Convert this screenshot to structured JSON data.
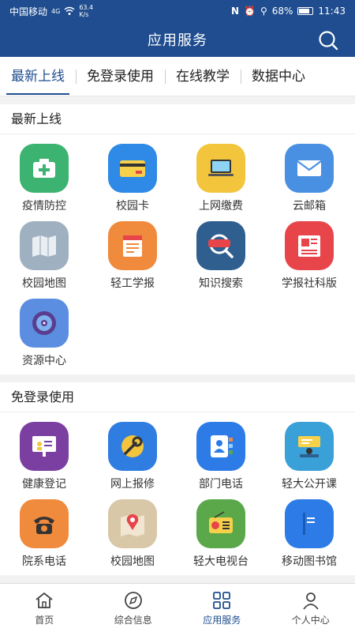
{
  "statusbar": {
    "carrier": "中国移动",
    "network": "4G",
    "speed_value": "63.4",
    "speed_unit": "K/s",
    "battery": "68%",
    "time": "11:43"
  },
  "header": {
    "title": "应用服务",
    "search_icon": "search-icon"
  },
  "tabs": [
    {
      "label": "最新上线",
      "active": true
    },
    {
      "label": "免登录使用",
      "active": false
    },
    {
      "label": "在线教学",
      "active": false
    },
    {
      "label": "数据中心",
      "active": false
    }
  ],
  "sections": [
    {
      "title": "最新上线",
      "items": [
        {
          "label": "疫情防控",
          "icon": "medical-kit-icon",
          "color": "#3cb371"
        },
        {
          "label": "校园卡",
          "icon": "card-icon",
          "color": "#2e8ae6"
        },
        {
          "label": "上网缴费",
          "icon": "laptop-icon",
          "color": "#f2c53d"
        },
        {
          "label": "云邮箱",
          "icon": "mail-icon",
          "color": "#4a90e2"
        },
        {
          "label": "校园地图",
          "icon": "map-icon",
          "color": "#9fb0c0"
        },
        {
          "label": "轻工学报",
          "icon": "report-icon",
          "color": "#f08a3c"
        },
        {
          "label": "知识搜索",
          "icon": "knowledge-search-icon",
          "color": "#2f5f8f"
        },
        {
          "label": "学报社科版",
          "icon": "newspaper-icon",
          "color": "#e8454a"
        },
        {
          "label": "资源中心",
          "icon": "disc-icon",
          "color": "#5b8de0"
        }
      ]
    },
    {
      "title": "免登录使用",
      "items": [
        {
          "label": "健康登记",
          "icon": "presentation-icon",
          "color": "#7a3fa0"
        },
        {
          "label": "网上报修",
          "icon": "repair-icon",
          "color": "#2f7de0"
        },
        {
          "label": "部门电话",
          "icon": "contacts-icon",
          "color": "#2d7be6"
        },
        {
          "label": "轻大公开课",
          "icon": "lecture-icon",
          "color": "#39a0d8"
        },
        {
          "label": "院系电话",
          "icon": "telephone-icon",
          "color": "#f08a3c"
        },
        {
          "label": "校园地图",
          "icon": "map-pin-icon",
          "color": "#d9c8a8"
        },
        {
          "label": "轻大电视台",
          "icon": "radio-icon",
          "color": "#5aa84a"
        },
        {
          "label": "移动图书馆",
          "icon": "book-icon",
          "color": "#2d7be6"
        }
      ]
    }
  ],
  "nav": [
    {
      "label": "首页",
      "icon": "home-icon",
      "active": false
    },
    {
      "label": "综合信息",
      "icon": "compass-icon",
      "active": false
    },
    {
      "label": "应用服务",
      "icon": "grid-icon",
      "active": true
    },
    {
      "label": "个人中心",
      "icon": "person-icon",
      "active": false
    }
  ]
}
